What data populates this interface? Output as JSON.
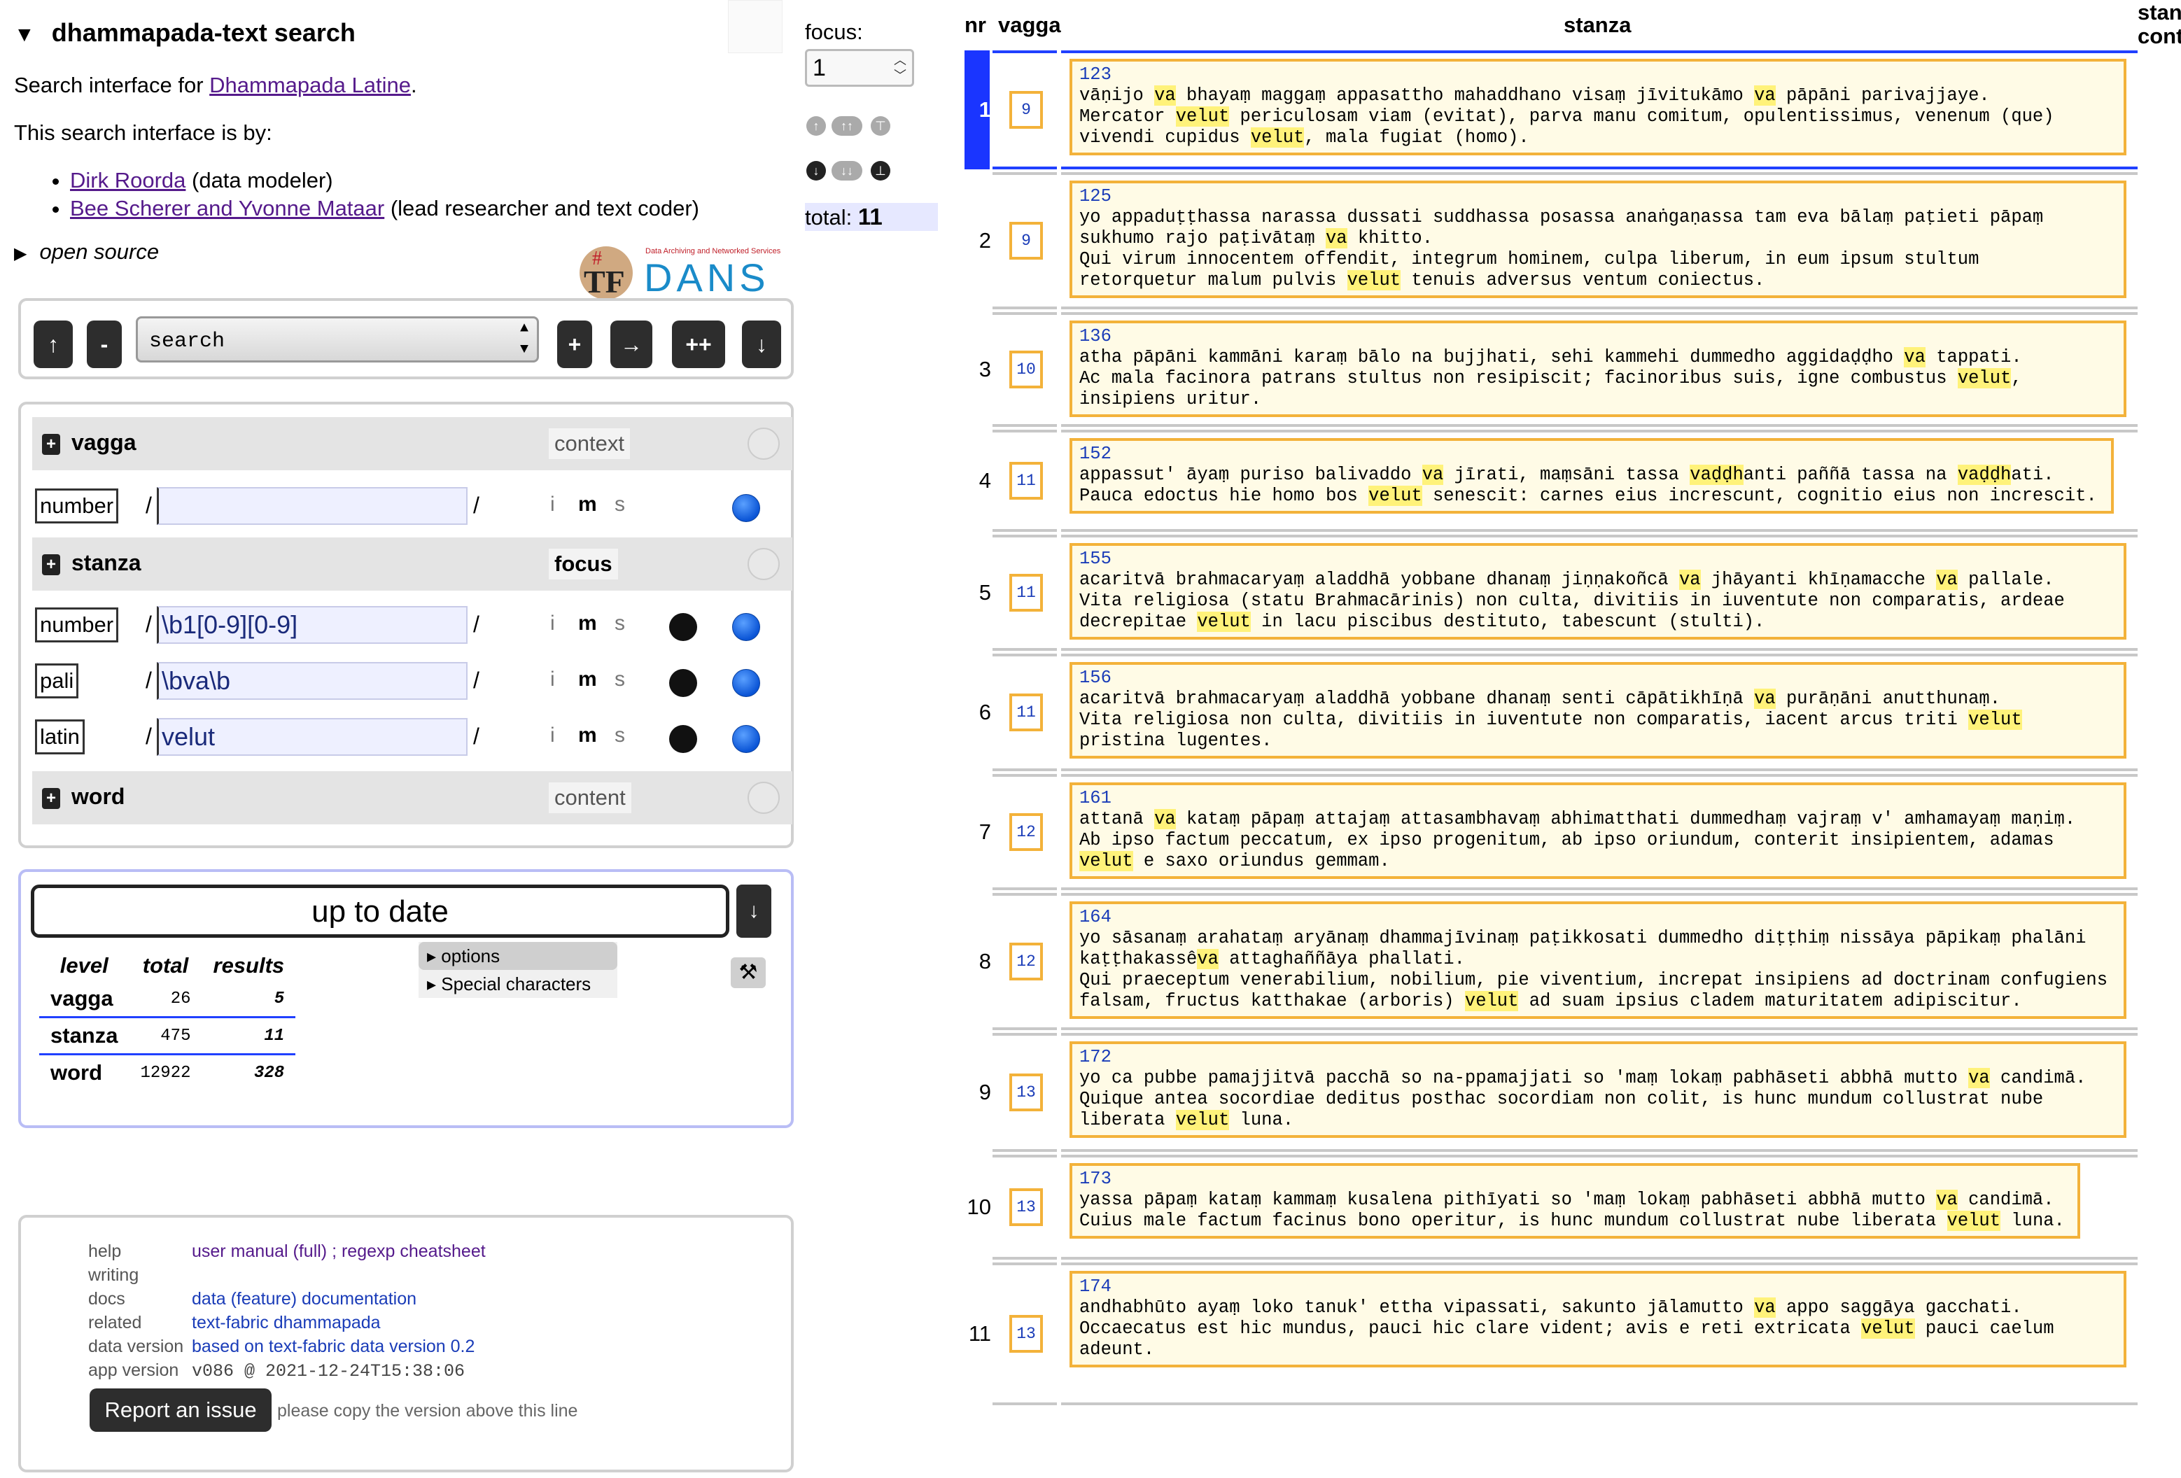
{
  "header": {
    "title": "dhammapada-text search",
    "intro_prefix": "Search interface for ",
    "intro_link": "Dhammapada Latine",
    "intro_suffix": ".",
    "by_line": "This search interface is by:",
    "credits": [
      {
        "link": "Dirk Roorda",
        "role": " (data modeler)"
      },
      {
        "link": "Bee Scherer and Yvonne Mataar",
        "role": " (lead researcher and text coder)"
      }
    ],
    "open_source": "open source",
    "logo_tf": "TF",
    "logo_hash": "#",
    "logo_dans": "DANS",
    "logo_tagline": "Data Archiving and Networked Services"
  },
  "nav": {
    "up": "↑",
    "minus": "-",
    "select_value": "search",
    "plus": "+",
    "right": "→",
    "plusplus": "++",
    "down": "↓"
  },
  "query": {
    "levels": [
      {
        "name": "vagga",
        "ctx": "context"
      },
      {
        "name": "stanza",
        "ctx": "focus"
      },
      {
        "name": "word",
        "ctx": "content"
      }
    ],
    "features": [
      {
        "label": "number",
        "value": "",
        "level": "vagga"
      },
      {
        "label": "number",
        "value": "\\b1[0-9][0-9]",
        "level": "stanza"
      },
      {
        "label": "pali",
        "value": "\\bva\\b",
        "level": "stanza"
      },
      {
        "label": "latin",
        "value": "velut",
        "level": "stanza"
      }
    ],
    "flags": [
      "i",
      "m",
      "s"
    ],
    "slash": "/"
  },
  "status": {
    "uptodate": "up to date",
    "down": "↓",
    "stats_headers": [
      "level",
      "total",
      "results"
    ],
    "stats": [
      {
        "level": "vagga",
        "total": "26",
        "results": "5"
      },
      {
        "level": "stanza",
        "total": "475",
        "results": "11"
      },
      {
        "level": "word",
        "total": "12922",
        "results": "328"
      }
    ],
    "options": "options",
    "special": "Special characters",
    "tool": "⚒"
  },
  "help": {
    "rows": [
      {
        "k": "help",
        "v": "user manual (full) ; regexp cheatsheet"
      },
      {
        "k": "writing",
        "v": ""
      },
      {
        "k": "docs",
        "v": "data (feature) documentation"
      },
      {
        "k": "related",
        "v": "text-fabric dhammapada"
      },
      {
        "k": "data version",
        "v": "based on text-fabric data version 0.2"
      },
      {
        "k": "app version",
        "v": "v086 @ 2021-12-24T15:38:06"
      }
    ],
    "report": "Report an issue",
    "report_note": "please copy the version above this line"
  },
  "focus": {
    "label": "focus:",
    "value": "1",
    "total_label": "total: ",
    "total_value": "11"
  },
  "results": {
    "col_nr": "nr",
    "col_vagga": "vagga",
    "col_stanza": "stanza",
    "col_stanza_ctx_1": "stan",
    "col_stanza_ctx_2": "cont",
    "rows": [
      {
        "nr": "1",
        "vagga": "9",
        "num": "123",
        "lines": [
          [
            "vāṇijo ",
            "va",
            " bhayaṃ maggaṃ appasattho mahaddhano visaṃ jīvitukāmo ",
            "va",
            " pāpāni parivajjaye."
          ],
          [
            "Mercator ",
            "velut",
            " periculosam viam (evitat), parva manu comitum, opulentissimus, venenum (que)"
          ],
          [
            "vivendi cupidus ",
            "velut",
            ", mala fugiat (homo)."
          ]
        ]
      },
      {
        "nr": "2",
        "vagga": "9",
        "num": "125",
        "lines": [
          [
            "yo appaduṭṭhassa narassa dussati suddhassa posassa anaṅgaṇassa tam eva bālaṃ paṭieti pāpaṃ"
          ],
          [
            "sukhumo rajo paṭivātaṃ ",
            "va",
            " khitto."
          ],
          [
            "Qui virum innocentem offendit, integrum hominem, culpa liberum, in eum ipsum stultum"
          ],
          [
            "retorquetur malum pulvis ",
            "velut",
            " tenuis adversus ventum coniectus."
          ]
        ]
      },
      {
        "nr": "3",
        "vagga": "10",
        "num": "136",
        "lines": [
          [
            "atha pāpāni kammāni karaṃ bālo na bujjhati, sehi kammehi dummedho aggidaḍḍho ",
            "va",
            " tappati."
          ],
          [
            "Ac mala facinora patrans stultus non resipiscit; facinoribus suis, igne combustus ",
            "velut",
            ","
          ],
          [
            "insipiens uritur."
          ]
        ]
      },
      {
        "nr": "4",
        "vagga": "11",
        "num": "152",
        "lines": [
          [
            "appassut' āyaṃ puriso balivaddo ",
            "va",
            " jīrati, maṃsāni tassa ",
            "vaḍḍh",
            "anti paññā tassa na ",
            "vaḍḍh",
            "ati."
          ],
          [
            "Pauca edoctus hie homo bos ",
            "velut",
            " senescit: carnes eius increscunt, cognitio eius non increscit."
          ]
        ]
      },
      {
        "nr": "5",
        "vagga": "11",
        "num": "155",
        "lines": [
          [
            "acaritvā brahmacaryaṃ aladdhā yobbane dhanaṃ jiṇṇakoñcā ",
            "va",
            " jhāyanti khīṇamacche ",
            "va",
            " pallale."
          ],
          [
            "Vita religiosa (statu Brahmacārinis) non culta, divitiis in iuventute non comparatis, ardeae"
          ],
          [
            "decrepitae ",
            "velut",
            " in lacu piscibus destituto, tabescunt (stulti)."
          ]
        ]
      },
      {
        "nr": "6",
        "vagga": "11",
        "num": "156",
        "lines": [
          [
            "acaritvā brahmacaryaṃ aladdhā yobbane dhanaṃ senti cāpātikhīṇā ",
            "va",
            " purāṇāni anutthunaṃ."
          ],
          [
            "Vita religiosa non culta, divitiis in iuventute non comparatis, iacent arcus triti ",
            "velut"
          ],
          [
            "pristina lugentes."
          ]
        ]
      },
      {
        "nr": "7",
        "vagga": "12",
        "num": "161",
        "lines": [
          [
            "attanā ",
            "va",
            " kataṃ pāpaṃ attajaṃ attasambhavaṃ abhimatthati dummedhaṃ vajraṃ v' amhamayaṃ maṇiṃ."
          ],
          [
            "Ab ipso factum peccatum, ex ipso progenitum, ab ipso oriundum, conterit insipientem, adamas"
          ],
          [
            "",
            "velut",
            " e saxo oriundus gemmam."
          ]
        ]
      },
      {
        "nr": "8",
        "vagga": "12",
        "num": "164",
        "lines": [
          [
            "yo sāsanaṃ arahataṃ aryānaṃ dhammajīvinaṃ paṭikkosati dummedho diṭṭhiṃ nissāya pāpikaṃ phalāni"
          ],
          [
            "kaṭṭhakassê",
            "va",
            " attaghaññāya phallati."
          ],
          [
            "Qui praeceptum venerabilium, nobilium, pie viventium, increpat insipiens ad doctrinam confugiens"
          ],
          [
            "falsam, fructus katthakae (arboris) ",
            "velut",
            " ad suam ipsius cladem maturitatem adipiscitur."
          ]
        ]
      },
      {
        "nr": "9",
        "vagga": "13",
        "num": "172",
        "lines": [
          [
            "yo ca pubbe pamajjitvā pacchā so na-ppamajjati so 'maṃ lokaṃ pabhāseti abbhā mutto ",
            "va",
            " candimā."
          ],
          [
            "Quique antea socordiae deditus posthac socordiam non colit, is hunc mundum collustrat nube"
          ],
          [
            "liberata ",
            "velut",
            " luna."
          ]
        ]
      },
      {
        "nr": "10",
        "vagga": "13",
        "num": "173",
        "lines": [
          [
            "yassa pāpaṃ kataṃ kammaṃ kusalena pithīyati so 'maṃ lokaṃ pabhāseti abbhā mutto ",
            "va",
            " candimā."
          ],
          [
            "Cuius male factum facinus bono operitur, is hunc mundum collustrat nube liberata ",
            "velut",
            " luna."
          ]
        ]
      },
      {
        "nr": "11",
        "vagga": "13",
        "num": "174",
        "lines": [
          [
            "andhabhūto ayaṃ loko tanuk' ettha vipassati, sakunto jālamutto ",
            "va",
            " appo saggāya gacchati."
          ],
          [
            "Occaecatus est hic mundus, pauci hic clare vident; avis e reti extricata ",
            "velut",
            " pauci caelum"
          ],
          [
            "adeunt."
          ]
        ]
      }
    ]
  },
  "colors": {
    "accent_blue": "#1a35ff",
    "highlight": "#fff27a",
    "box_orange": "#f3b23a"
  }
}
